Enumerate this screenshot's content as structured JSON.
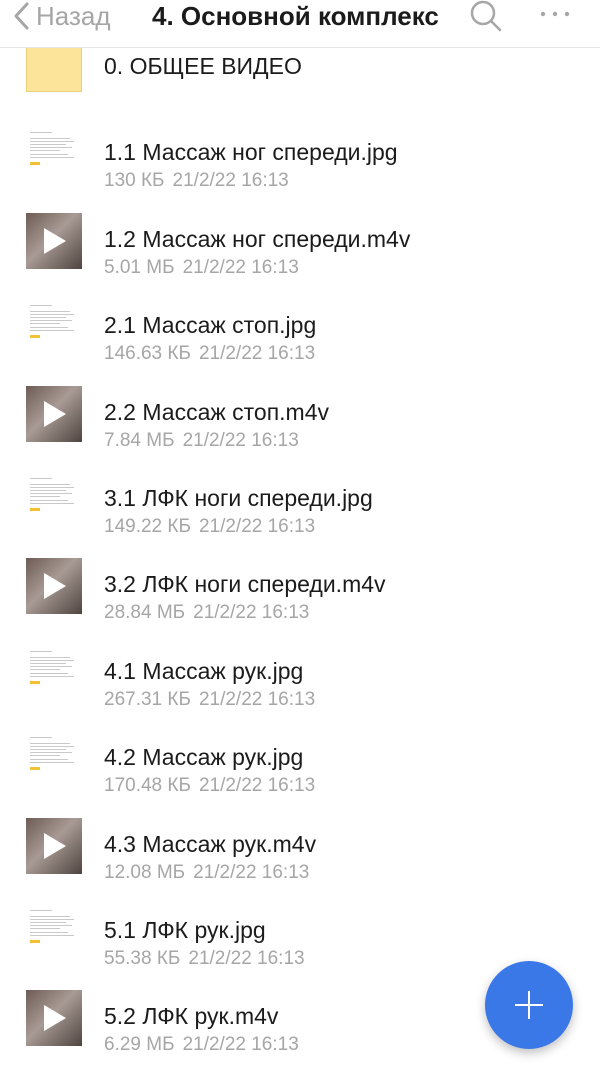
{
  "header": {
    "back_label": "Назад",
    "title": "4. Основной комплекс",
    "search_icon": "search-icon",
    "more_icon": "more-horizontal-icon"
  },
  "files": [
    {
      "name": "0. ОБЩЕЕ ВИДЕО",
      "type": "folder",
      "size": "",
      "date": ""
    },
    {
      "name": "1.1 Массаж ног спереди.jpg",
      "type": "image",
      "size": "130 КБ",
      "date": "21/2/22 16:13"
    },
    {
      "name": "1.2 Массаж ног спереди.m4v",
      "type": "video",
      "size": "5.01 МБ",
      "date": "21/2/22 16:13"
    },
    {
      "name": "2.1 Массаж стоп.jpg",
      "type": "image",
      "size": "146.63 КБ",
      "date": "21/2/22 16:13"
    },
    {
      "name": "2.2 Массаж стоп.m4v",
      "type": "video",
      "size": "7.84 МБ",
      "date": "21/2/22 16:13"
    },
    {
      "name": "3.1 ЛФК ноги спереди.jpg",
      "type": "image",
      "size": "149.22 КБ",
      "date": "21/2/22 16:13"
    },
    {
      "name": "3.2 ЛФК ноги спереди.m4v",
      "type": "video",
      "size": "28.84 МБ",
      "date": "21/2/22 16:13"
    },
    {
      "name": "4.1 Массаж рук.jpg",
      "type": "image",
      "size": "267.31 КБ",
      "date": "21/2/22 16:13"
    },
    {
      "name": "4.2 Массаж рук.jpg",
      "type": "image",
      "size": "170.48 КБ",
      "date": "21/2/22 16:13"
    },
    {
      "name": "4.3 Массаж рук.m4v",
      "type": "video",
      "size": "12.08 МБ",
      "date": "21/2/22 16:13"
    },
    {
      "name": "5.1 ЛФК рук.jpg",
      "type": "image",
      "size": "55.38 КБ",
      "date": "21/2/22 16:13"
    },
    {
      "name": "5.2 ЛФК рук.m4v",
      "type": "video",
      "size": "6.29 МБ",
      "date": "21/2/22 16:13"
    }
  ],
  "fab": {
    "icon": "plus-icon",
    "color": "#3b78e7"
  },
  "colors": {
    "folder": "#fce59b",
    "secondary_text": "#a6a6a6",
    "primary_text": "#1b1b1b"
  }
}
